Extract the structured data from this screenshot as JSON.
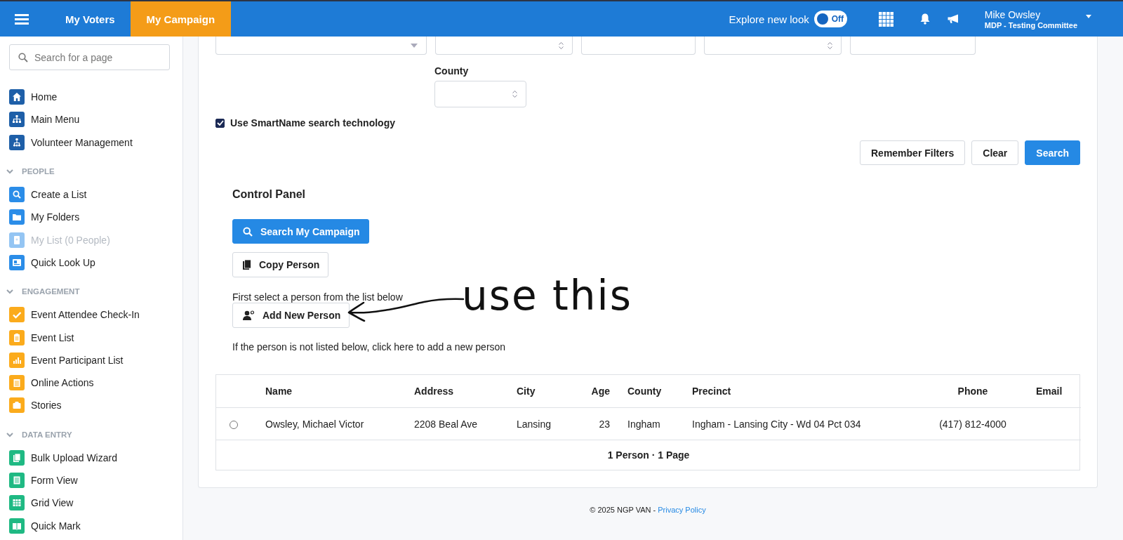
{
  "header": {
    "tabs": [
      {
        "label": "My Voters",
        "selected": false
      },
      {
        "label": "My Campaign",
        "selected": true
      }
    ],
    "new_look": {
      "label": "Explore new look",
      "on": false,
      "state_text": "Off"
    },
    "user": {
      "name": "Mike Owsley",
      "organization": "MDP - Testing Committee"
    }
  },
  "sidebar": {
    "search": {
      "placeholder": "Search for a page"
    },
    "groups": [
      {
        "color": "#1e5fa8",
        "items": [
          {
            "label": "Home",
            "disabled": false
          },
          {
            "label": "Main Menu",
            "disabled": false
          },
          {
            "label": "Volunteer Management",
            "disabled": false
          }
        ]
      },
      {
        "title": "PEOPLE",
        "expanded": true,
        "color": "#2b8de8",
        "items": [
          {
            "label": "Create a List",
            "disabled": false
          },
          {
            "label": "My Folders",
            "disabled": false
          },
          {
            "label": "My List (0 People)",
            "disabled": true
          },
          {
            "label": "Quick Look Up",
            "disabled": false
          }
        ]
      },
      {
        "title": "ENGAGEMENT",
        "expanded": true,
        "color": "#fbab1c",
        "items": [
          {
            "label": "Event Attendee Check-In",
            "disabled": false
          },
          {
            "label": "Event List",
            "disabled": false
          },
          {
            "label": "Event Participant List",
            "disabled": false
          },
          {
            "label": "Online Actions",
            "disabled": false
          },
          {
            "label": "Stories",
            "disabled": false
          }
        ]
      },
      {
        "title": "DATA ENTRY",
        "expanded": true,
        "color": "#1fb983",
        "items": [
          {
            "label": "Bulk Upload Wizard",
            "disabled": false
          },
          {
            "label": "Form View",
            "disabled": false
          },
          {
            "label": "Grid View",
            "disabled": false
          },
          {
            "label": "Quick Mark",
            "disabled": false
          }
        ]
      }
    ]
  },
  "filters": {
    "top_fields": [
      {
        "kind": "dropdown"
      },
      {
        "kind": "select"
      },
      {
        "kind": "text"
      },
      {
        "kind": "select"
      },
      {
        "kind": "text"
      }
    ],
    "county": {
      "label": "County",
      "kind": "select"
    },
    "smartname": {
      "label": "Use SmartName search technology",
      "checked": true
    },
    "buttons": [
      {
        "label": "Remember Filters",
        "kind": "default"
      },
      {
        "label": "Clear",
        "kind": "default"
      },
      {
        "label": "Search",
        "kind": "primary"
      }
    ]
  },
  "control_panel": {
    "title": "Control Panel",
    "search_button": "Search My Campaign",
    "copy_button": "Copy Person",
    "copy_hint": "First select a person from the list below",
    "add_button": "Add New Person",
    "add_hint": "If the person is not listed below, click here to add a new person"
  },
  "annotation": {
    "text": "use this"
  },
  "table": {
    "columns": [
      "Name",
      "Address",
      "City",
      "Age",
      "County",
      "Precinct",
      "Phone",
      "Email"
    ],
    "rows": [
      {
        "selected": false,
        "cells": [
          "Owsley, Michael Victor",
          "2208 Beal Ave",
          "Lansing",
          "23",
          "Ingham",
          "Ingham - Lansing City - Wd 04 Pct 034",
          "(417) 812-4000"
        ]
      }
    ],
    "summary": "1 Person · 1 Page"
  },
  "footer": {
    "copyright": "© 2025 NGP VAN -",
    "link": "Privacy Policy"
  }
}
